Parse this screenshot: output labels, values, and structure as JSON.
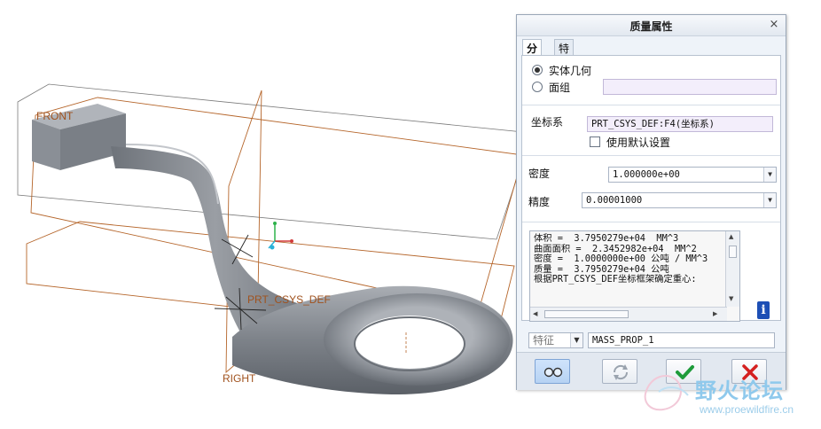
{
  "viewport": {
    "datum_labels": {
      "front": "FRONT",
      "right": "RIGHT",
      "csys": "PRT_CSYS_DEF"
    }
  },
  "dialog": {
    "title": "质量属性",
    "close_glyph": "×",
    "tabs": [
      {
        "label": "分析",
        "active": true
      },
      {
        "label": "特征",
        "active": false
      }
    ],
    "geometry_type": {
      "options": [
        {
          "label": "实体几何",
          "selected": true
        },
        {
          "label": "面组",
          "selected": false
        }
      ],
      "quilt_value": ""
    },
    "coordinate_system": {
      "label": "坐标系",
      "value": "PRT_CSYS_DEF:F4(坐标系)",
      "use_default_label": "使用默认设置",
      "use_default_checked": false
    },
    "density": {
      "label": "密度",
      "value": "1.000000e+00"
    },
    "precision": {
      "label": "精度",
      "value": "0.00001000"
    },
    "results_lines": [
      "体积 =  3.7950279e+04  MM^3",
      "曲面面积 =  2.3452982e+04  MM^2",
      "密度 =  1.0000000e+00 公吨 / MM^3",
      "质量 =  3.7950279e+04 公吨",
      "",
      "根据PRT_CSYS_DEF坐标框架确定重心:"
    ],
    "feature": {
      "type_label": "特征",
      "name_value": "MASS_PROP_1"
    },
    "buttons": {
      "preview_icon": "glasses-icon",
      "repeat_icon": "refresh-icon",
      "ok_icon": "checkmark-icon",
      "cancel_icon": "x-cancel-icon"
    },
    "colors": {
      "ok": "#1e9b3a",
      "cancel": "#d42020",
      "info": "#1d4fb5"
    }
  },
  "watermark": {
    "name": "野火论坛",
    "url": "www.proewildfire.cn"
  }
}
